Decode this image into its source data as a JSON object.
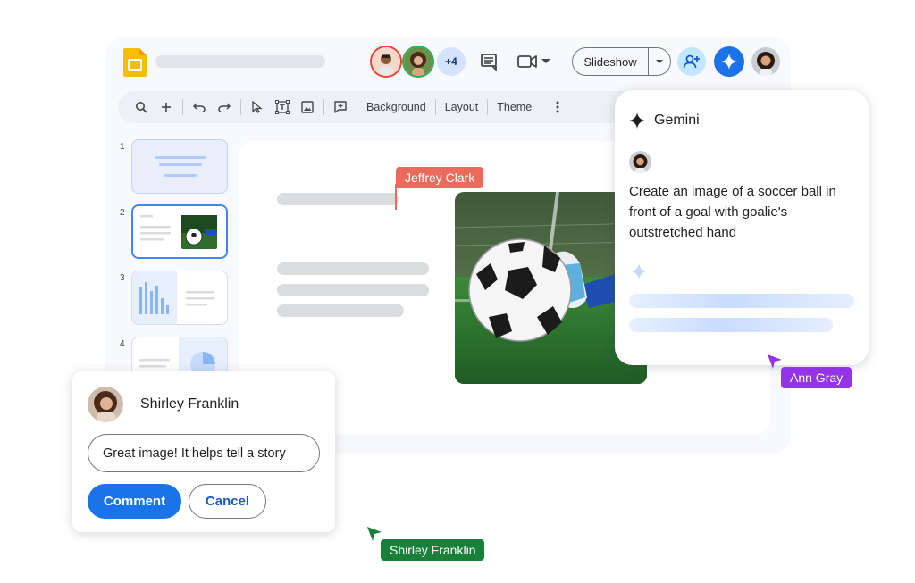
{
  "header": {
    "presence_more_count": "+4",
    "slideshow_label": "Slideshow",
    "icons": [
      "slides-logo-icon",
      "comments-icon",
      "meet-video-icon",
      "share-user-icon",
      "gemini-icon"
    ]
  },
  "toolbar": {
    "background_label": "Background",
    "layout_label": "Layout",
    "theme_label": "Theme"
  },
  "filmstrip": {
    "slides": [
      {
        "number": "1"
      },
      {
        "number": "2"
      },
      {
        "number": "3"
      },
      {
        "number": "4"
      }
    ]
  },
  "collaborators": {
    "jeffrey": "Jeffrey Clark",
    "ann": "Ann Gray",
    "shirley": "Shirley Franklin"
  },
  "gemini": {
    "title": "Gemini",
    "prompt": "Create an image of a soccer ball in front of a goal with goalie's outstretched hand"
  },
  "comment": {
    "author": "Shirley Franklin",
    "input_value": "Great image! It helps tell a story",
    "comment_label": "Comment",
    "cancel_label": "Cancel"
  },
  "colors": {
    "accent": "#1a73e8",
    "jeffrey_tag": "#ea6a5b",
    "ann_tag": "#9334e6",
    "shirley_tag": "#188038",
    "slides_logo": "#fbbc04"
  }
}
